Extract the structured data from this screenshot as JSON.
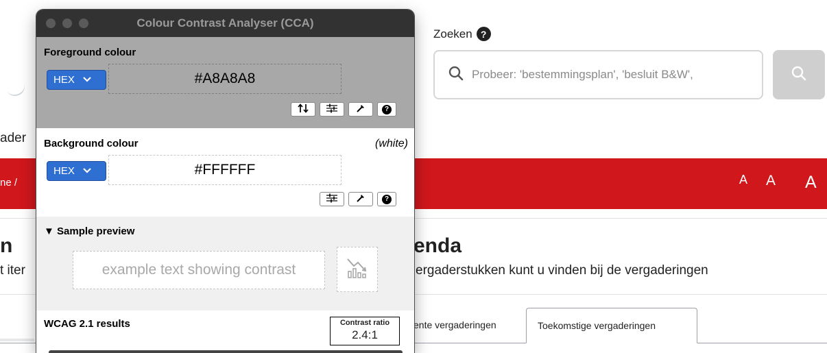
{
  "website": {
    "search_label": "Zoeken",
    "search_placeholder": "Probeer: 'bestemmingsplan', 'besluit B&W',",
    "nav_fragment": "ader",
    "breadcrumb_fragment": "ne  /",
    "font_size_controls": [
      "A",
      "A",
      "A"
    ],
    "heading_left_fragment": "n",
    "subtitle_left_fragment": "t iter",
    "heading_right_fragment": "enda",
    "subtitle_right_fragment": "ergaderstukken kunt u vinden bij de vergaderingen",
    "tabs": {
      "previous": "ente vergaderingen",
      "upcoming": "Toekomstige vergaderingen"
    },
    "colors": {
      "brand_red": "#d0171c"
    }
  },
  "cca": {
    "title": "Colour Contrast Analyser (CCA)",
    "foreground": {
      "label": "Foreground colour",
      "format": "HEX",
      "value": "#A8A8A8"
    },
    "background": {
      "label": "Background colour",
      "note": "(white)",
      "format": "HEX",
      "value": "#FFFFFF"
    },
    "sample": {
      "title": "▼ Sample preview",
      "text": "example text showing contrast"
    },
    "results": {
      "title": "WCAG 2.1 results",
      "ratio_label": "Contrast ratio",
      "ratio_value": "2.4:1"
    },
    "icons": [
      "swap-icon",
      "sliders-icon",
      "eyedropper-icon",
      "help-icon",
      "chart-icon",
      "search-icon"
    ]
  }
}
